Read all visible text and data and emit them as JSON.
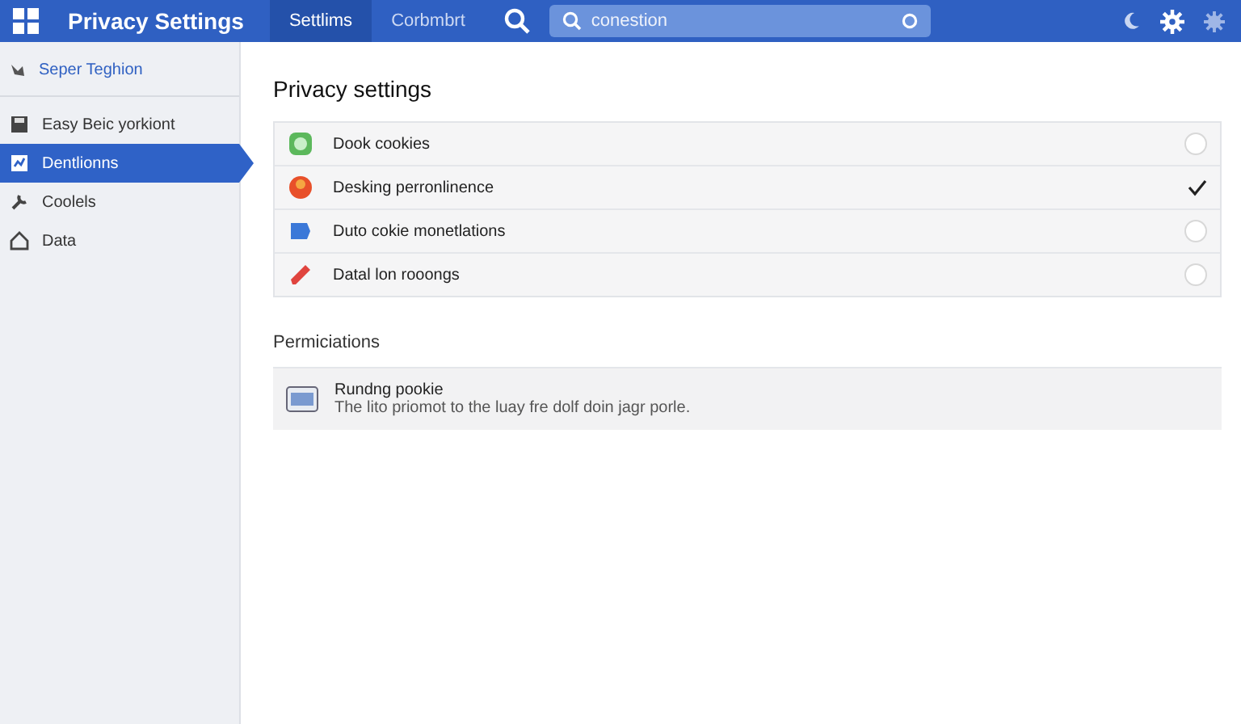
{
  "header": {
    "title": "Privacy Settings",
    "tabs": [
      {
        "label": "Settlims",
        "selected": true
      },
      {
        "label": "Corbmbrt",
        "selected": false
      }
    ],
    "search": {
      "placeholder": "conestion"
    }
  },
  "sidebar": {
    "heading": "Seper Teghion",
    "items": [
      {
        "label": "Easy Beic yorkiont",
        "selected": false
      },
      {
        "label": "Dentlionns",
        "selected": true
      },
      {
        "label": "Coolels",
        "selected": false
      },
      {
        "label": "Data",
        "selected": false
      }
    ]
  },
  "main": {
    "title": "Privacy settings",
    "settings": [
      {
        "label": "Dook cookies",
        "checked": false
      },
      {
        "label": "Desking perronlinence",
        "checked": true
      },
      {
        "label": "Duto cokie monetlations",
        "checked": false
      },
      {
        "label": "Datal lon rooongs",
        "checked": false
      }
    ],
    "permissions_title": "Permiciations",
    "permissions": [
      {
        "title": "Rundng pookie",
        "description": "The lito priomot to the luay fre dolf doin jagr porle."
      }
    ]
  }
}
